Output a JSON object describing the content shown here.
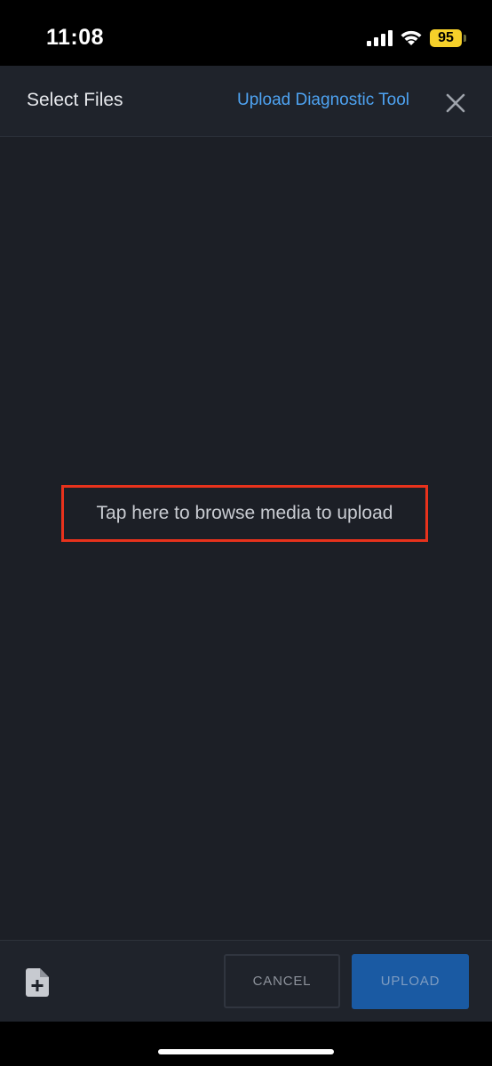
{
  "status_bar": {
    "time": "11:08",
    "battery_level": "95",
    "icons": [
      "cellular-signal-icon",
      "wifi-icon",
      "battery-icon"
    ]
  },
  "header": {
    "title": "Select Files",
    "link": "Upload Diagnostic Tool",
    "close_icon": "close-icon"
  },
  "drop_area": {
    "prompt": "Tap here to browse media to upload"
  },
  "footer": {
    "add_file_icon": "add-file-icon",
    "cancel_label": "CANCEL",
    "upload_label": "UPLOAD"
  },
  "colors": {
    "background": "#1c1f26",
    "link": "#4ea3f2",
    "upload_button": "#1a5aa3",
    "highlight_border": "#e8321c",
    "battery": "#f5d02a"
  }
}
